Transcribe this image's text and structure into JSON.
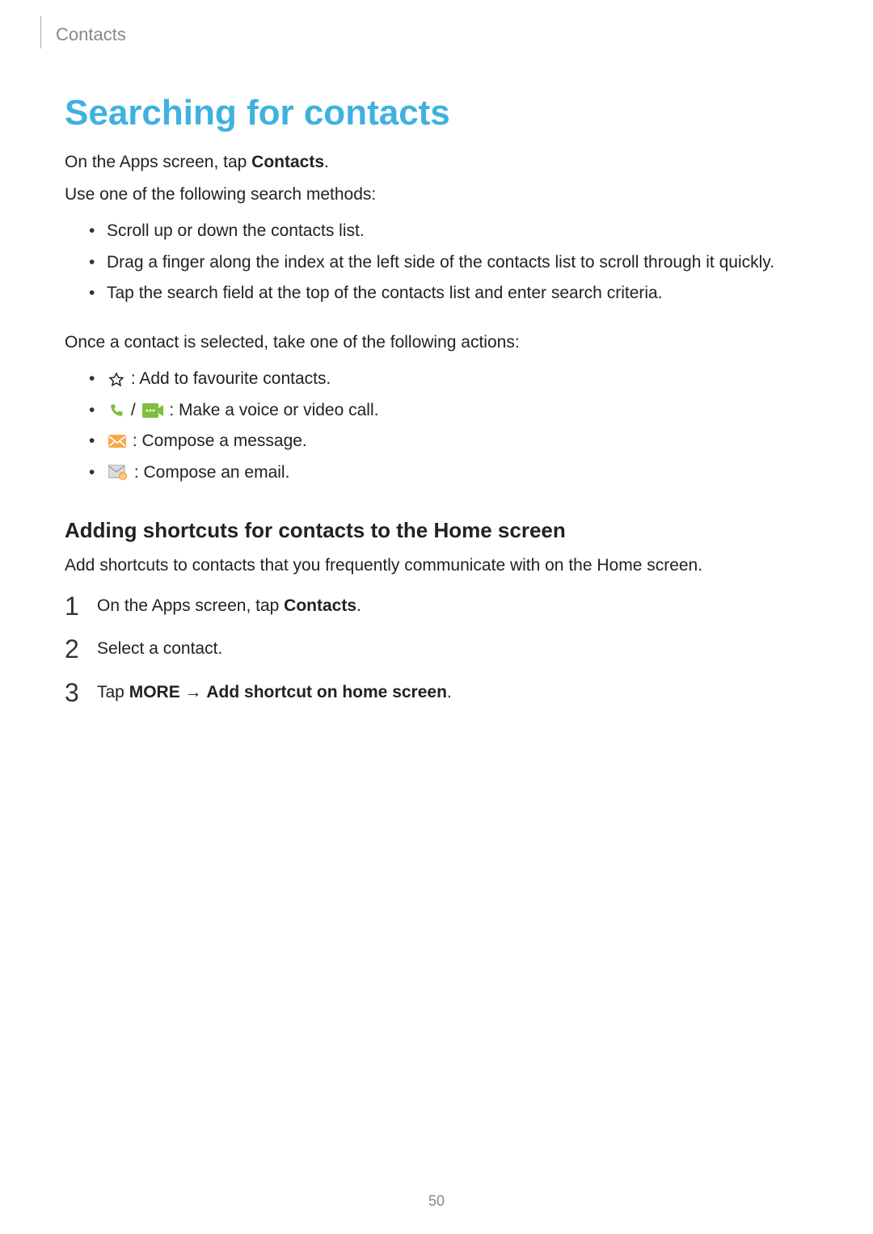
{
  "header": {
    "section": "Contacts"
  },
  "title": "Searching for contacts",
  "intro": {
    "line1_pre": "On the Apps screen, tap ",
    "line1_bold": "Contacts",
    "line1_post": ".",
    "line2": "Use one of the following search methods:"
  },
  "search_methods": [
    "Scroll up or down the contacts list.",
    "Drag a finger along the index at the left side of the contacts list to scroll through it quickly.",
    "Tap the search field at the top of the contacts list and enter search criteria."
  ],
  "after_select": "Once a contact is selected, take one of the following actions:",
  "actions": {
    "favourite": " : Add to favourite contacts.",
    "call_sep": " / ",
    "call": " : Make a voice or video call.",
    "message": " : Compose a message.",
    "email": " : Compose an email."
  },
  "sub_heading": "Adding shortcuts for contacts to the Home screen",
  "sub_body": "Add shortcuts to contacts that you frequently communicate with on the Home screen.",
  "steps": {
    "s1_pre": "On the Apps screen, tap ",
    "s1_bold": "Contacts",
    "s1_post": ".",
    "s2": "Select a contact.",
    "s3_pre": "Tap ",
    "s3_bold1": "MORE",
    "s3_arrow": " → ",
    "s3_bold2": "Add shortcut on home screen",
    "s3_post": "."
  },
  "page_number": "50"
}
